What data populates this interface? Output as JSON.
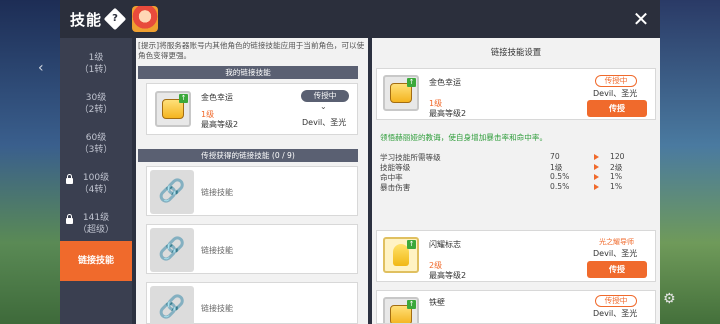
{
  "header": {
    "title": "技能"
  },
  "sidebar": {
    "items": [
      {
        "label": "1级",
        "sub": "（1转）"
      },
      {
        "label": "30级",
        "sub": "（2转）"
      },
      {
        "label": "60级",
        "sub": "（3转）"
      },
      {
        "label": "100级",
        "sub": "（4转）"
      },
      {
        "label": "141级",
        "sub": "（超级）"
      },
      {
        "label": "链接技能"
      }
    ]
  },
  "left": {
    "tip": "[提示]将服务器账号内其他角色的链接技能应用于当前角色，可以使角色变得更强。",
    "my_section": "我的链接技能",
    "my_skill": {
      "name": "金色幸运",
      "level": "1级",
      "max": "最高等级2",
      "status": "传授中",
      "owner": "Devil、圣光"
    },
    "inherited_section": "传授获得的链接技能 (0 / 9)",
    "placeholder_label": "链接技能"
  },
  "right": {
    "header": "链接技能设置",
    "skills": [
      {
        "name": "金色幸运",
        "level": "1级",
        "max": "最高等级2",
        "badge": "传授中",
        "owner": "Devil、圣光",
        "button": "传授"
      },
      {
        "name": "闪耀标志",
        "level": "2级",
        "max": "最高等级2",
        "badge": "光之耀导师",
        "owner": "Devil、圣光",
        "button": "传授"
      },
      {
        "name": "铁壁",
        "badge": "传授中",
        "owner": "Devil、圣光"
      }
    ],
    "description": "领悟赫丽娅的教诲，使自身增加暴击率和命中率。",
    "stats": [
      {
        "label": "学习技能所需等级",
        "from": "70",
        "to": "120"
      },
      {
        "label": "技能等级",
        "from": "1级",
        "to": "2级"
      },
      {
        "label": "命中率",
        "from": "0.5%",
        "to": "1%"
      },
      {
        "label": "暴击伤害",
        "from": "0.5%",
        "to": "1%"
      }
    ]
  },
  "colors": {
    "accent": "#f06a2c",
    "panel": "#2c3140",
    "desc_green": "#2e9d3a"
  }
}
